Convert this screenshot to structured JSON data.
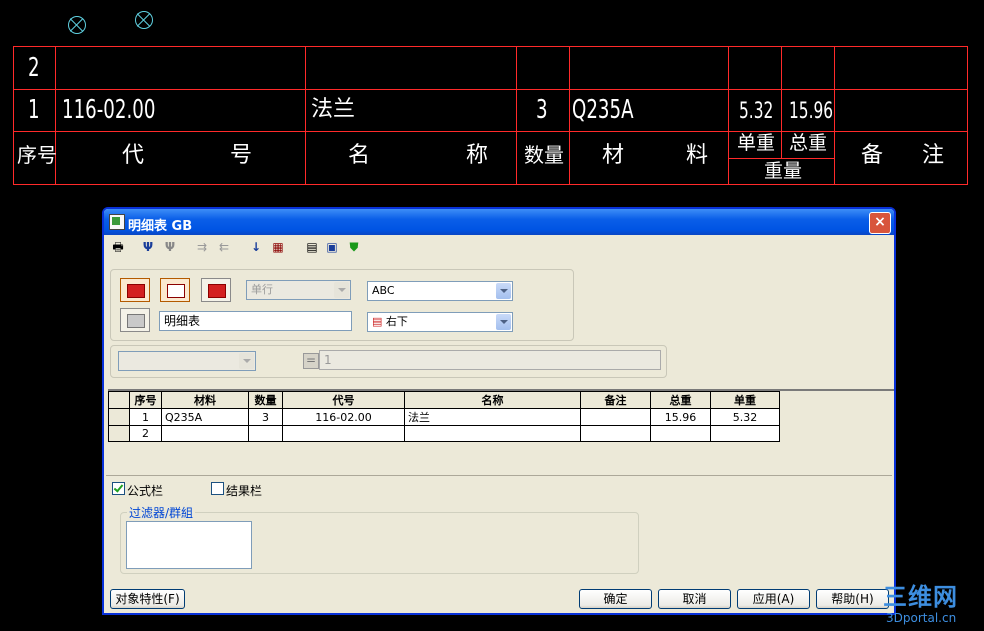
{
  "cad": {
    "row_numbers": [
      "2",
      "1"
    ],
    "row1": {
      "code": "116-02.00",
      "name": "法兰",
      "qty": "3",
      "material": "Q235A",
      "unit_weight": "5.32",
      "total_weight": "15.96"
    },
    "header": {
      "seq": "序号",
      "code_a": "代",
      "code_b": "号",
      "name_a": "名",
      "name_b": "称",
      "qty": "数量",
      "material_a": "材",
      "material_b": "料",
      "unit_weight": "单重",
      "total_weight": "总重",
      "weight": "重量",
      "remark_a": "备",
      "remark_b": "注"
    }
  },
  "dialog": {
    "title": "明细表 GB",
    "close": "×",
    "toolbar_icons": [
      "print-icon",
      "insert-row-icon",
      "delete-row-icon",
      "merge-icon",
      "split-icon",
      "sort-icon",
      "table-icon",
      "copy-icon",
      "save-icon",
      "shield-icon"
    ],
    "style_row_select": "单行",
    "font_select": "ABC",
    "name_input": "明细表",
    "position_select": "右下",
    "formula_value": "1",
    "formula_eq": "=",
    "grid": {
      "headers": [
        "序号",
        "材料",
        "数量",
        "代号",
        "名称",
        "备注",
        "总重",
        "单重"
      ],
      "rows": [
        [
          "1",
          "Q235A",
          "3",
          "116-02.00",
          "法兰",
          "",
          "15.96",
          "5.32"
        ],
        [
          "2",
          "",
          "",
          "",
          "",
          "",
          "",
          ""
        ]
      ]
    },
    "formula_bar_label": "公式栏",
    "formula_bar_checked": true,
    "result_bar_label": "结果栏",
    "result_bar_checked": false,
    "filter_group_label": "过滤器/群組",
    "object_props_button": "对象特性(F)",
    "ok_button": "确定",
    "cancel_button": "取消",
    "apply_button": "应用(A)",
    "help_button": "帮助(H)"
  },
  "watermark": {
    "main": "三维网",
    "sub": "3Dportal.cn"
  },
  "colors": {
    "cad_lines": "#ff2a2a",
    "symbol": "#5fd0e0",
    "title_blue": "#0054e3",
    "legend_blue": "#0046d5"
  }
}
